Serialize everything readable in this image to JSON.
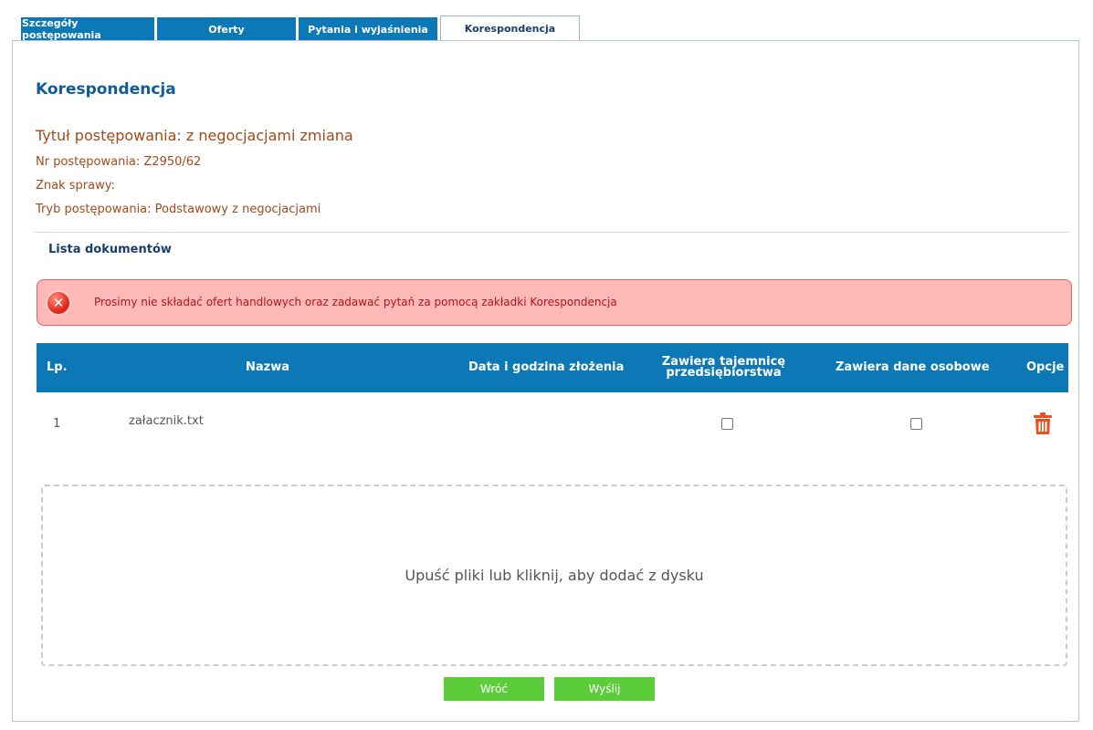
{
  "tabs": [
    {
      "label": "Szczegóły postępowania"
    },
    {
      "label": "Oferty"
    },
    {
      "label": "Pytania i wyjaśnienia"
    },
    {
      "label": "Korespondencja"
    }
  ],
  "page_title": "Korespondencja",
  "proceeding": {
    "title": "Tytuł postępowania: z negocjacjami zmiana",
    "number": "Nr postępowania: Z2950/62",
    "case_mark": "Znak sprawy:",
    "mode": "Tryb postępowania: Podstawowy z negocjacjami"
  },
  "section_label": "Lista dokumentów",
  "alert": {
    "message": "Prosimy nie składać ofert handlowych oraz zadawać pytań za pomocą zakładki Korespondencja",
    "icon": "error-x-icon",
    "color": "#fdb8b8"
  },
  "table": {
    "headers": {
      "lp": "Lp.",
      "name": "Nazwa",
      "date": "Data i godzina złożenia",
      "secret_line1": "Zawiera tajemnicę",
      "secret_line2": "przedsiębiorstwa",
      "personal": "Zawiera dane osobowe",
      "options": "Opcje"
    },
    "rows": [
      {
        "lp": "1",
        "name": "załacznik.txt",
        "date": "",
        "contains_secret": false,
        "contains_personal": false
      }
    ]
  },
  "dropzone": {
    "text": "Upuść pliki lub kliknij, aby dodać z dysku"
  },
  "buttons": {
    "back": "Wróć",
    "send": "Wyślij"
  },
  "colors": {
    "accent": "#0c78b6",
    "button": "#5dcc3a",
    "heading": "#125b9a",
    "info_text": "#a34a1a",
    "delete": "#e8501e"
  }
}
